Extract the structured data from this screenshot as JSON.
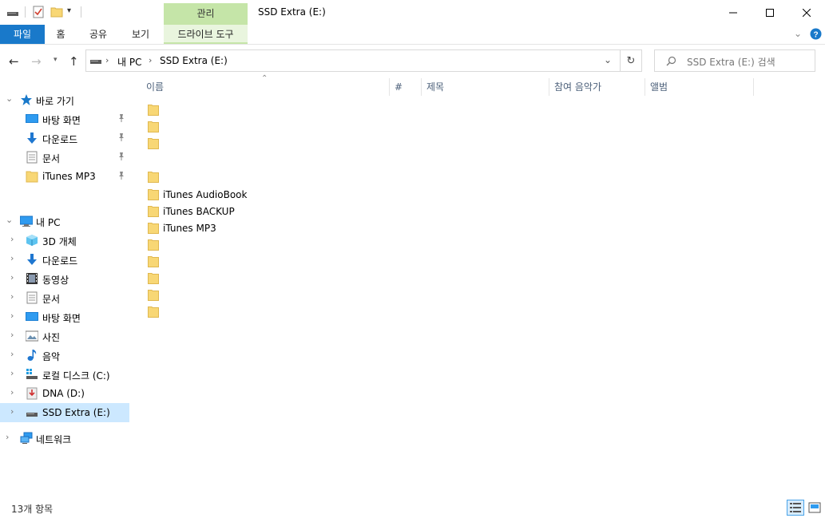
{
  "window": {
    "title": "SSD Extra (E:)",
    "manage_tab": "관리"
  },
  "ribbon": {
    "tabs": [
      {
        "label": "파일"
      },
      {
        "label": "홈"
      },
      {
        "label": "공유"
      },
      {
        "label": "보기"
      },
      {
        "label": "드라이브 도구"
      }
    ]
  },
  "address": {
    "breadcrumb": [
      "내 PC",
      "SSD Extra (E:)"
    ],
    "search_placeholder": "SSD Extra (E:) 검색"
  },
  "nav_pane": {
    "quick_access": {
      "label": "바로 가기",
      "items": [
        {
          "label": "바탕 화면",
          "icon": "desktop-icon"
        },
        {
          "label": "다운로드",
          "icon": "download-icon"
        },
        {
          "label": "문서",
          "icon": "document-icon"
        },
        {
          "label": "iTunes MP3",
          "icon": "folder-icon"
        }
      ]
    },
    "this_pc": {
      "label": "내 PC",
      "items": [
        {
          "label": "3D 개체",
          "icon": "cube-icon"
        },
        {
          "label": "다운로드",
          "icon": "download-icon"
        },
        {
          "label": "동영상",
          "icon": "video-icon"
        },
        {
          "label": "문서",
          "icon": "document-icon"
        },
        {
          "label": "바탕 화면",
          "icon": "desktop-icon"
        },
        {
          "label": "사진",
          "icon": "picture-icon"
        },
        {
          "label": "음악",
          "icon": "music-icon"
        },
        {
          "label": "로컬 디스크 (C:)",
          "icon": "windows-drive-icon"
        },
        {
          "label": "DNA (D:)",
          "icon": "drive-icon"
        },
        {
          "label": "SSD Extra (E:)",
          "icon": "drive-icon",
          "selected": true
        }
      ]
    },
    "network": {
      "label": "네트워크"
    }
  },
  "content": {
    "columns": [
      "이름",
      "#",
      "제목",
      "참여 음악가",
      "앨범"
    ],
    "files": [
      {
        "name": ""
      },
      {
        "name": ""
      },
      {
        "name": ""
      },
      {
        "name": ""
      },
      {
        "name": "iTunes AudioBook"
      },
      {
        "name": "iTunes BACKUP"
      },
      {
        "name": "iTunes MP3"
      },
      {
        "name": ""
      },
      {
        "name": ""
      },
      {
        "name": ""
      },
      {
        "name": ""
      },
      {
        "name": ""
      }
    ]
  },
  "status": {
    "item_count": "13개 항목"
  },
  "colors": {
    "accent": "#1979ca",
    "manage_tab": "#c5e5a8",
    "selected_nav": "#cce8ff",
    "folder": "#f8d775"
  }
}
